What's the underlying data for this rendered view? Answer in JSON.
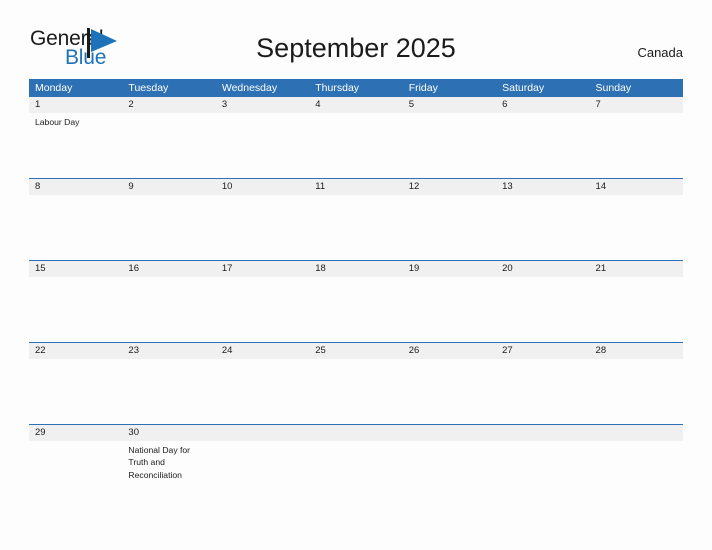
{
  "brand": {
    "name_top": "General",
    "name_bottom": "Blue",
    "flag_icon": "flag-triangle-icon",
    "color_top": "#1b1b1b",
    "color_bottom": "#1e72b8"
  },
  "header": {
    "title": "September 2025",
    "country": "Canada"
  },
  "colors": {
    "header_blue": "#2d70b3",
    "date_band_gray": "#f0f0f0",
    "page_background": "#fdfdfd",
    "text": "#1b1b1b"
  },
  "calendar": {
    "weekdays": [
      "Monday",
      "Tuesday",
      "Wednesday",
      "Thursday",
      "Friday",
      "Saturday",
      "Sunday"
    ],
    "weeks": [
      {
        "days": [
          {
            "date": "1",
            "event": "Labour Day"
          },
          {
            "date": "2",
            "event": ""
          },
          {
            "date": "3",
            "event": ""
          },
          {
            "date": "4",
            "event": ""
          },
          {
            "date": "5",
            "event": ""
          },
          {
            "date": "6",
            "event": ""
          },
          {
            "date": "7",
            "event": ""
          }
        ]
      },
      {
        "days": [
          {
            "date": "8",
            "event": ""
          },
          {
            "date": "9",
            "event": ""
          },
          {
            "date": "10",
            "event": ""
          },
          {
            "date": "11",
            "event": ""
          },
          {
            "date": "12",
            "event": ""
          },
          {
            "date": "13",
            "event": ""
          },
          {
            "date": "14",
            "event": ""
          }
        ]
      },
      {
        "days": [
          {
            "date": "15",
            "event": ""
          },
          {
            "date": "16",
            "event": ""
          },
          {
            "date": "17",
            "event": ""
          },
          {
            "date": "18",
            "event": ""
          },
          {
            "date": "19",
            "event": ""
          },
          {
            "date": "20",
            "event": ""
          },
          {
            "date": "21",
            "event": ""
          }
        ]
      },
      {
        "days": [
          {
            "date": "22",
            "event": ""
          },
          {
            "date": "23",
            "event": ""
          },
          {
            "date": "24",
            "event": ""
          },
          {
            "date": "25",
            "event": ""
          },
          {
            "date": "26",
            "event": ""
          },
          {
            "date": "27",
            "event": ""
          },
          {
            "date": "28",
            "event": ""
          }
        ]
      },
      {
        "days": [
          {
            "date": "29",
            "event": ""
          },
          {
            "date": "30",
            "event": "National Day for Truth and Reconciliation"
          },
          {
            "date": "",
            "event": ""
          },
          {
            "date": "",
            "event": ""
          },
          {
            "date": "",
            "event": ""
          },
          {
            "date": "",
            "event": ""
          },
          {
            "date": "",
            "event": ""
          }
        ]
      }
    ]
  }
}
